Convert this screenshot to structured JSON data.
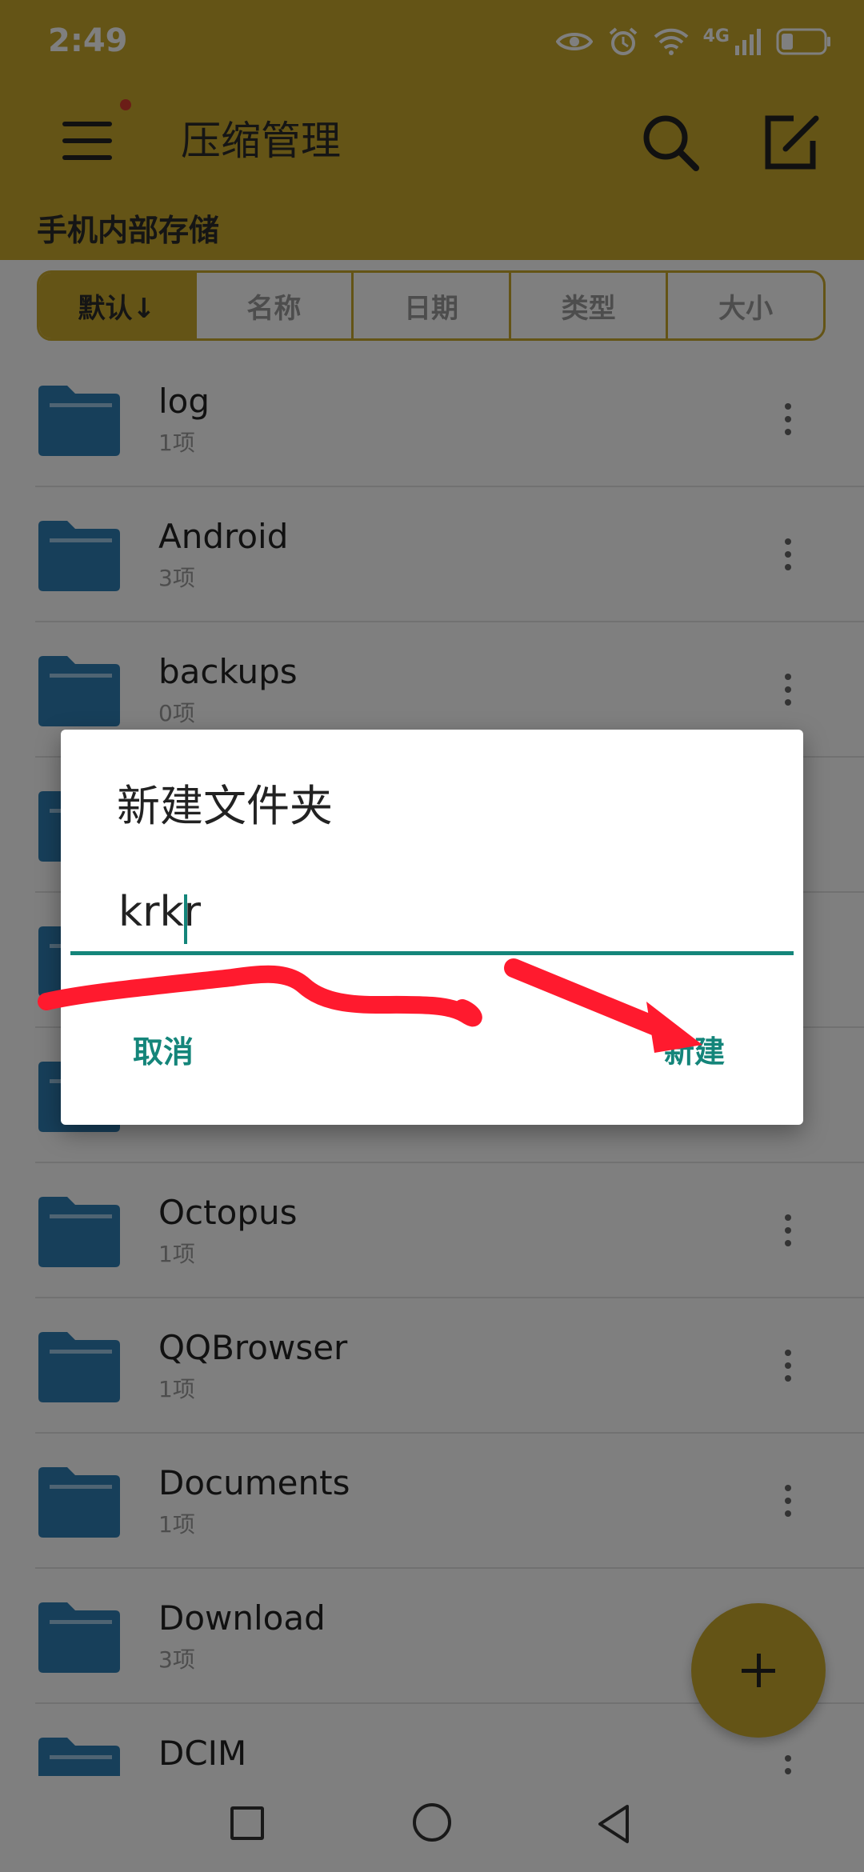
{
  "status_bar": {
    "time": "2:49",
    "network": "4G"
  },
  "app_bar": {
    "title": "压缩管理"
  },
  "path": {
    "label": "手机内部存储"
  },
  "sort_tabs": [
    {
      "label": "默认↓",
      "active": true
    },
    {
      "label": "名称",
      "active": false
    },
    {
      "label": "日期",
      "active": false
    },
    {
      "label": "类型",
      "active": false
    },
    {
      "label": "大小",
      "active": false
    }
  ],
  "files": [
    {
      "name": "log",
      "count": "1项"
    },
    {
      "name": "Android",
      "count": "3项"
    },
    {
      "name": "backups",
      "count": "0项"
    },
    {
      "name": "",
      "count": ""
    },
    {
      "name": "",
      "count": ""
    },
    {
      "name": "",
      "count": ""
    },
    {
      "name": "Octopus",
      "count": "1项"
    },
    {
      "name": "QQBrowser",
      "count": "1项"
    },
    {
      "name": "Documents",
      "count": "1项"
    },
    {
      "name": "Download",
      "count": "3项"
    },
    {
      "name": "DCIM",
      "count": ""
    }
  ],
  "dialog": {
    "title": "新建文件夹",
    "input_value": "krkr",
    "cancel_label": "取消",
    "create_label": "新建"
  },
  "colors": {
    "header": "#c9a82c",
    "accent": "#14857a",
    "folder": "#2f7fb5",
    "annotation": "#ff1a2e"
  },
  "icons": {
    "menu": "menu-icon",
    "search": "search-icon",
    "edit": "edit-icon",
    "folder": "folder-icon",
    "more": "more-vertical-icon",
    "add": "plus-icon"
  }
}
